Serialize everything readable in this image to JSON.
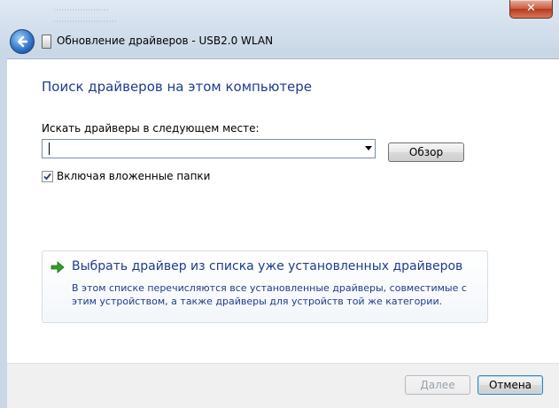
{
  "window": {
    "title": "Обновление драйверов - USB2.0 WLAN",
    "close_label": "✕"
  },
  "heading": "Поиск драйверов на этом компьютере",
  "search": {
    "label": "Искать драйверы в следующем месте:",
    "value": "",
    "browse_label": "Обзор"
  },
  "include_subfolders": {
    "label": "Включая вложенные папки",
    "checked": true
  },
  "pick_driver": {
    "title": "Выбрать драйвер из списка уже установленных драйверов",
    "description": "В этом списке перечисляются все установленные драйверы, совместимые с этим устройством, а также драйверы для устройств той же категории."
  },
  "footer": {
    "next_label": "Далее",
    "cancel_label": "Отмена"
  },
  "colors": {
    "link_blue": "#1e3c8c",
    "close_red": "#c75b3f",
    "arrow_green": "#2f9e2f"
  },
  "icons": {
    "back": "back-arrow-icon",
    "device": "usb-device-icon",
    "link_arrow": "green-arrow-icon",
    "checkbox": "checkmark-icon",
    "dropdown": "chevron-down-icon"
  }
}
